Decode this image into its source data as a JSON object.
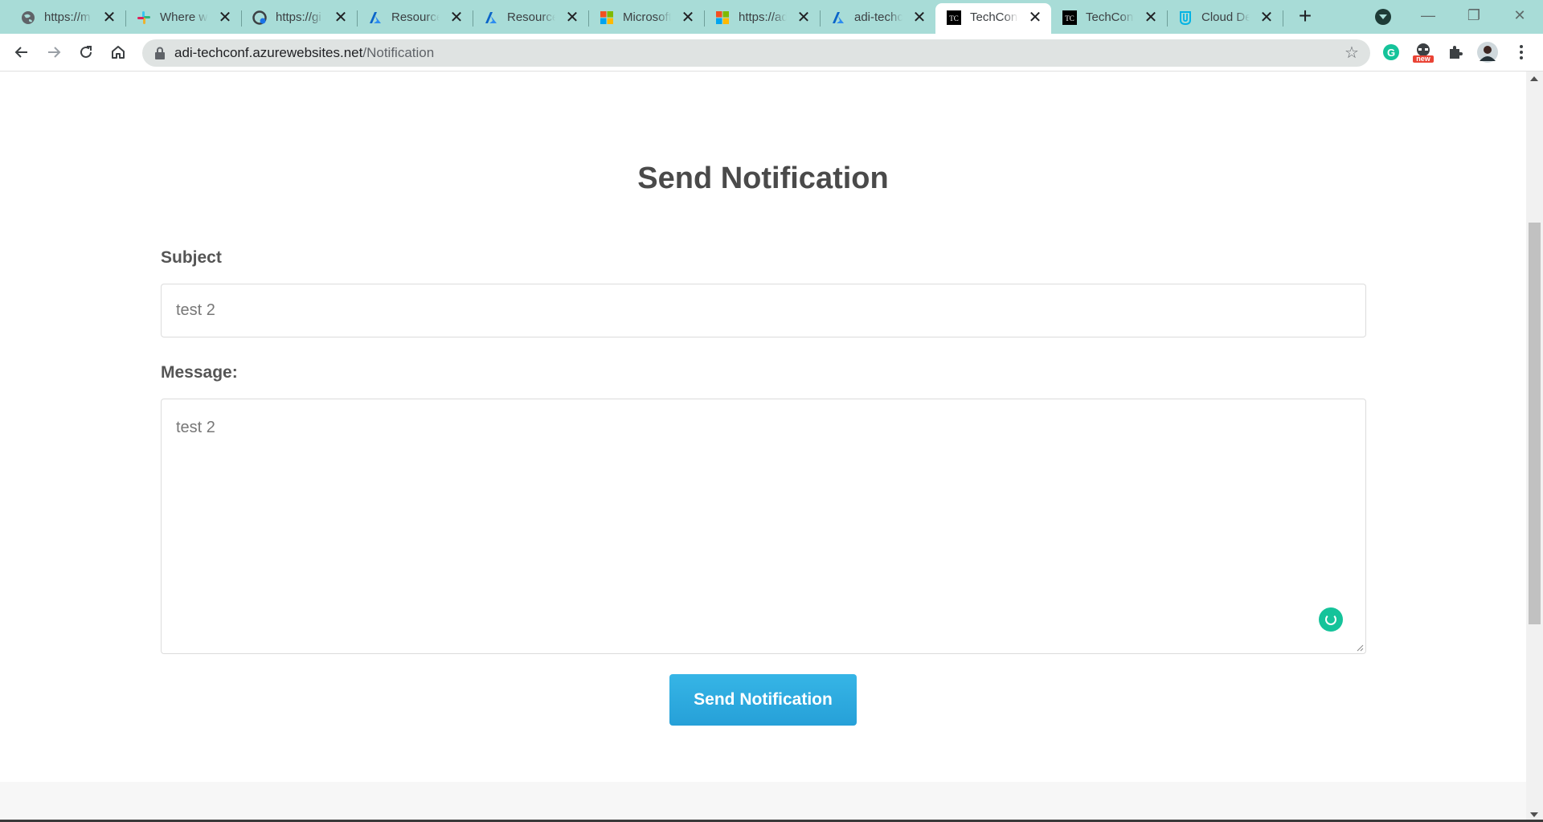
{
  "browser": {
    "tabs": [
      {
        "title": "https://m",
        "icon": "globe-icon",
        "active": false
      },
      {
        "title": "Where wo",
        "icon": "slack-icon",
        "active": false
      },
      {
        "title": "https://gi",
        "icon": "github-icon",
        "active": false
      },
      {
        "title": "Resource",
        "icon": "azure-icon",
        "active": false
      },
      {
        "title": "Resource",
        "icon": "azure-icon",
        "active": false
      },
      {
        "title": "Microsoft",
        "icon": "microsoft-icon",
        "active": false
      },
      {
        "title": "https://ad",
        "icon": "microsoft-icon",
        "active": false
      },
      {
        "title": "adi-techc",
        "icon": "azure-icon",
        "active": false
      },
      {
        "title": "TechConf",
        "icon": "tc-icon",
        "active": true
      },
      {
        "title": "TechConf",
        "icon": "tc-icon",
        "active": false
      },
      {
        "title": "Cloud De",
        "icon": "udacity-icon",
        "active": false
      }
    ],
    "tab_close_glyph": "✕",
    "new_tab_glyph": "+",
    "url_host": "adi-techconf.azurewebsites.net",
    "url_path": "/Notification",
    "bookmark_glyph": "☆",
    "extension_badge": "new",
    "window_controls": {
      "minimize": "—",
      "restore": "❐",
      "close": "✕"
    },
    "colors": {
      "tabstrip": "#a8dcd7",
      "omnibox": "#dfe3e2"
    }
  },
  "page": {
    "title": "Send Notification",
    "subject_label": "Subject",
    "subject_value": "test 2",
    "message_label": "Message:",
    "message_value": "test 2",
    "submit_label": "Send Notification",
    "colors": {
      "button": "#2aa8de",
      "heading": "#4a4a4a",
      "grammarly": "#15c39a"
    }
  }
}
